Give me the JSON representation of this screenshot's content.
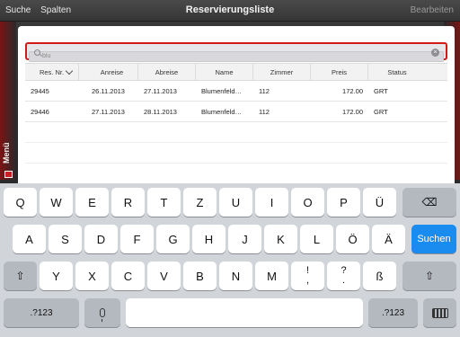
{
  "navbar": {
    "left_items": [
      "Suche",
      "Spalten"
    ],
    "title": "Reservierungsliste",
    "right_action": "Bearbeiten"
  },
  "side_menu": {
    "label": "Menü"
  },
  "search": {
    "value": "blu"
  },
  "table": {
    "columns": [
      "Res. Nr.",
      "Anreise",
      "Abreise",
      "Name",
      "Zimmer",
      "Preis",
      "Status"
    ],
    "rows": [
      [
        "29445",
        "26.11.2013",
        "27.11.2013",
        "Blumenfeld…",
        "112",
        "172.00",
        "GRT"
      ],
      [
        "29446",
        "27.11.2013",
        "28.11.2013",
        "Blumenfeld…",
        "112",
        "172.00",
        "GRT"
      ]
    ]
  },
  "keyboard": {
    "row1": [
      "Q",
      "W",
      "E",
      "R",
      "T",
      "Z",
      "U",
      "I",
      "O",
      "P",
      "Ü"
    ],
    "row2": [
      "A",
      "S",
      "D",
      "F",
      "G",
      "H",
      "J",
      "K",
      "L",
      "Ö",
      "Ä"
    ],
    "row3": [
      "Y",
      "X",
      "C",
      "V",
      "B",
      "N",
      "M"
    ],
    "punct1": {
      "top": "!",
      "bottom": ","
    },
    "punct2": {
      "top": "?",
      "bottom": "."
    },
    "sharp_s": "ß",
    "search_key": "Suchen",
    "numbers_key": ".?123",
    "icons": [
      "backspace-icon",
      "shift-icon",
      "microphone-icon",
      "keyboard-hide-icon"
    ]
  }
}
